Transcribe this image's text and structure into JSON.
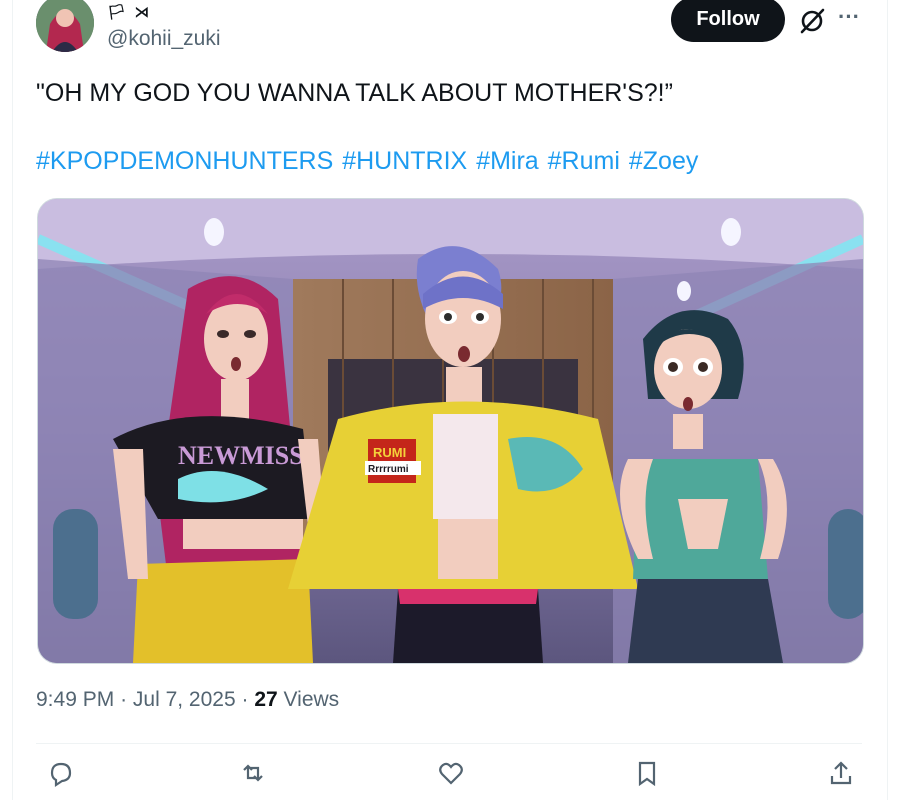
{
  "author": {
    "display_name": "🏳 ⋊",
    "handle": "@kohii_zuki"
  },
  "header": {
    "follow_label": "Follow",
    "more_label": "···"
  },
  "tweet": {
    "text": "\"OH MY GOD YOU WANNA TALK ABOUT MOTHER'S?!”",
    "hashtags": [
      "#KPOPDEMONHUNTERS",
      "#HUNTRIX",
      "#Mira",
      "#Rumi",
      "#Zoey"
    ]
  },
  "media": {
    "jacket_patch_text": "RUMI",
    "jacket_tag_text": "Rrrrrumi",
    "shirt_text": "NEWMISS"
  },
  "meta": {
    "time": "9:49 PM",
    "separator": "·",
    "date": "Jul 7, 2025",
    "views_count": "27",
    "views_label": "Views"
  },
  "icons": {
    "reply": "reply-icon",
    "repost": "repost-icon",
    "like": "like-icon",
    "bookmark": "bookmark-icon",
    "share": "share-icon",
    "grok": "grok-icon",
    "more": "more-icon"
  },
  "colors": {
    "link": "#1d9bf0",
    "text": "#0f1419",
    "secondary": "#536471",
    "follow_bg": "#0f1419"
  }
}
